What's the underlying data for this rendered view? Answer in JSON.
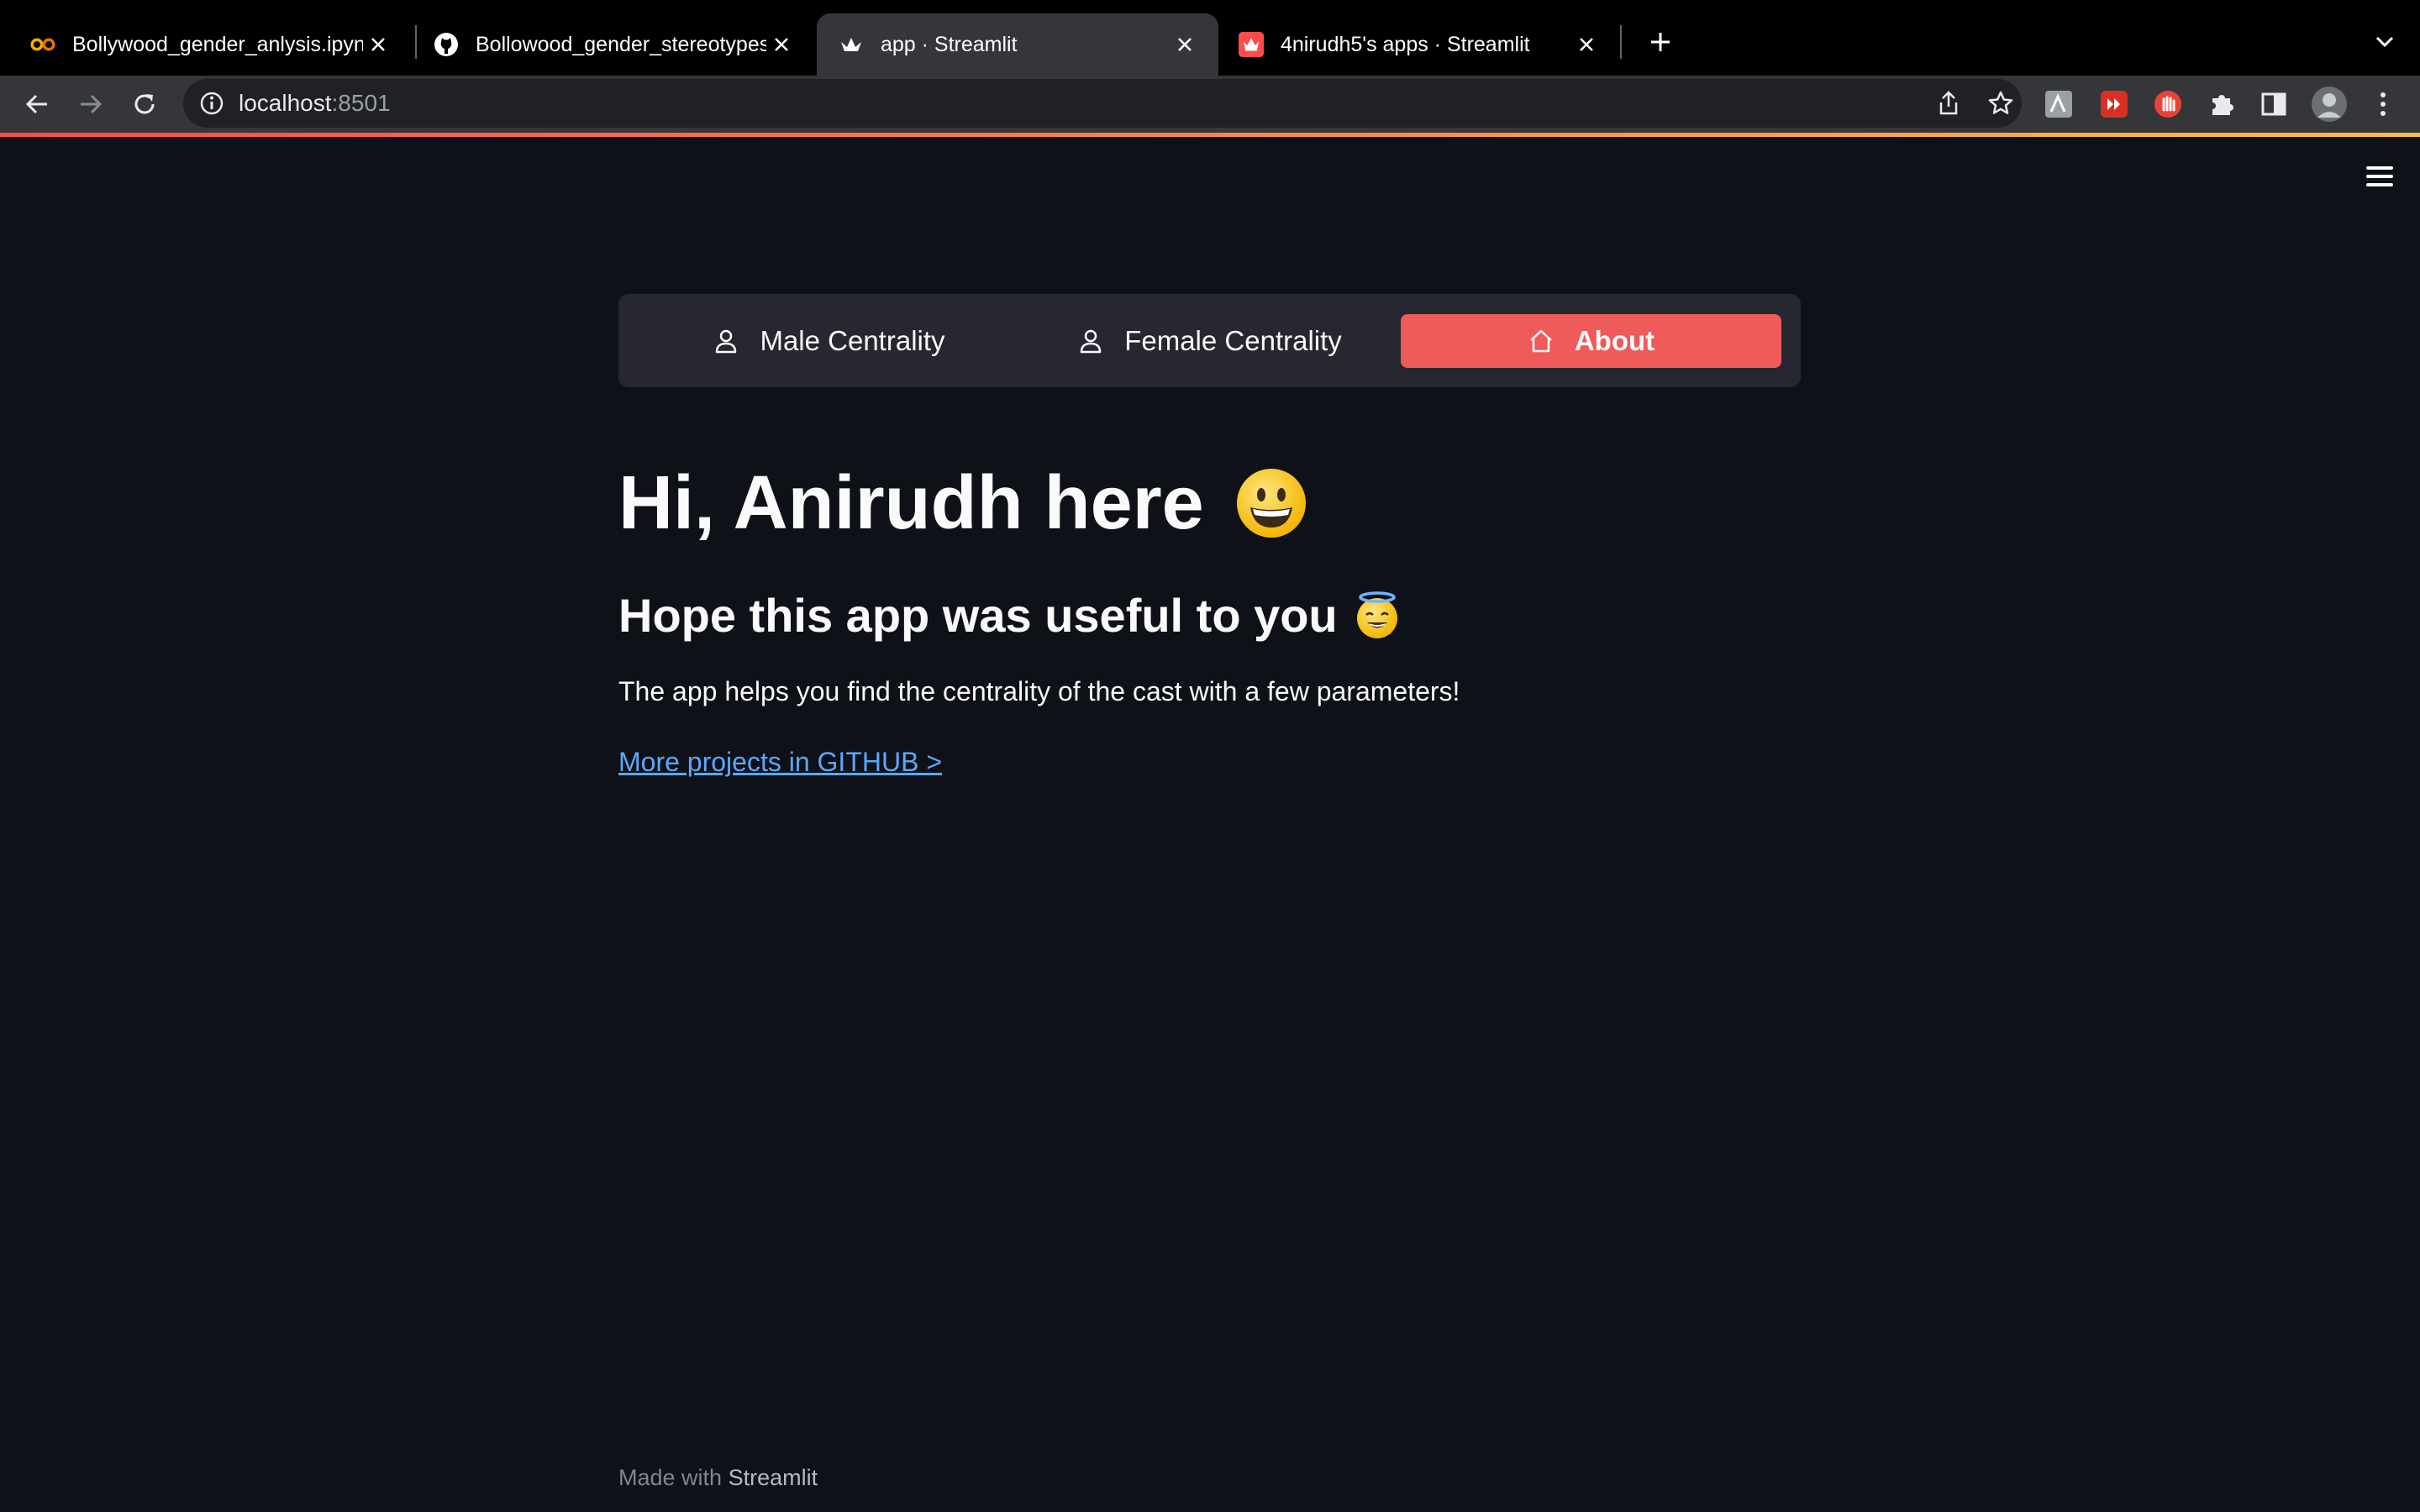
{
  "browser": {
    "tabs": [
      {
        "title": "Bollywood_gender_anlysis.ipynb",
        "favicon": "colab-icon"
      },
      {
        "title": "Bollowood_gender_stereotypes",
        "favicon": "github-icon"
      },
      {
        "title": "app · Streamlit",
        "favicon": "streamlit-icon"
      },
      {
        "title": "4nirudh5's apps · Streamlit",
        "favicon": "streamlit-cloud-icon"
      }
    ],
    "active_tab": 2,
    "url_host": "localhost",
    "url_port": ":8501"
  },
  "app": {
    "nav": {
      "items": [
        {
          "label": "Male Centrality",
          "icon": "person-icon"
        },
        {
          "label": "Female Centrality",
          "icon": "person-icon"
        },
        {
          "label": "About",
          "icon": "house-icon"
        }
      ],
      "active_index": 2
    },
    "heading": "Hi, Anirudh here",
    "heading_emoji": "grinning-face-emoji",
    "subheading": "Hope this app was useful to you",
    "subheading_emoji": "smiling-face-with-halo-emoji",
    "description": "The app helps you find the centrality of the cast with a few parameters!",
    "link_text": "More projects in GITHUB >",
    "footer_prefix": "Made with ",
    "footer_brand": "Streamlit"
  },
  "colors": {
    "app_background": "#0e1117",
    "nav_background": "#262730",
    "active_nav": "#ef5a5a",
    "link": "#5ca8ff",
    "decoration_start": "#ff4b4b",
    "decoration_end": "#ffbd45"
  }
}
